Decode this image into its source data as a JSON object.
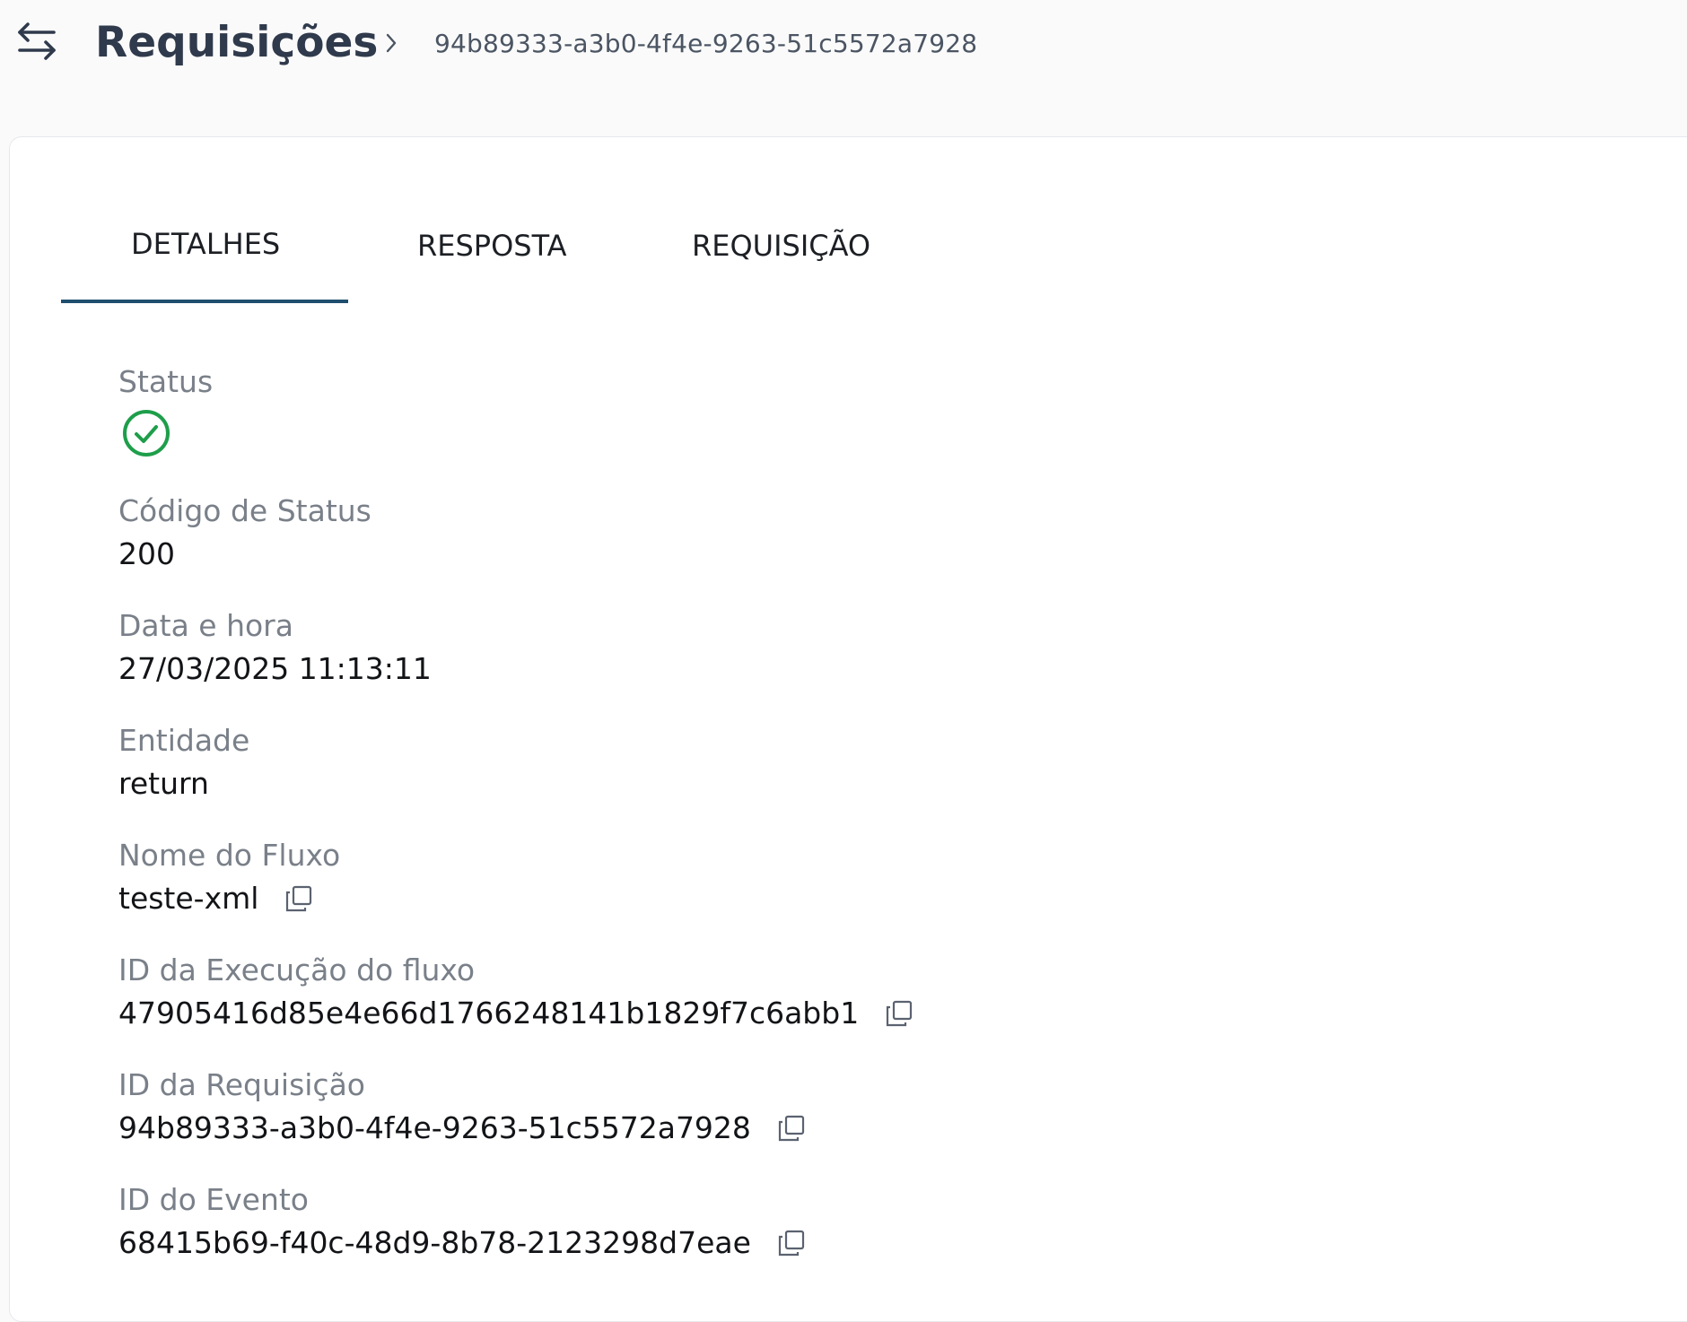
{
  "header": {
    "title": "Requisições",
    "back_icon": "swap-arrows-icon",
    "breadcrumb_separator_icon": "chevron-right-icon",
    "breadcrumb_id": "94b89333-a3b0-4f4e-9263-51c5572a7928"
  },
  "tabs": [
    {
      "label": "DETALHES",
      "active": true
    },
    {
      "label": "RESPOSTA",
      "active": false
    },
    {
      "label": "REQUISIÇÃO",
      "active": false
    }
  ],
  "colors": {
    "accent": "#1f4e6e",
    "success": "#1e9e4a",
    "title": "#2f3a4c",
    "label": "#7a8089"
  },
  "details": {
    "status": {
      "label": "Status",
      "icon": "check-circle-icon"
    },
    "status_code": {
      "label": "Código de Status",
      "value": "200"
    },
    "datetime": {
      "label": "Data e hora",
      "value": "27/03/2025 11:13:11"
    },
    "entity": {
      "label": "Entidade",
      "value": "return"
    },
    "flow_name": {
      "label": "Nome do Fluxo",
      "value": "teste-xml"
    },
    "flow_execution_id": {
      "label": "ID da Execução do fluxo",
      "value": "47905416d85e4e66d1766248141b1829f7c6abb1"
    },
    "request_id": {
      "label": "ID da Requisição",
      "value": "94b89333-a3b0-4f4e-9263-51c5572a7928"
    },
    "event_id": {
      "label": "ID do Evento",
      "value": "68415b69-f40c-48d9-8b78-2123298d7eae"
    }
  }
}
